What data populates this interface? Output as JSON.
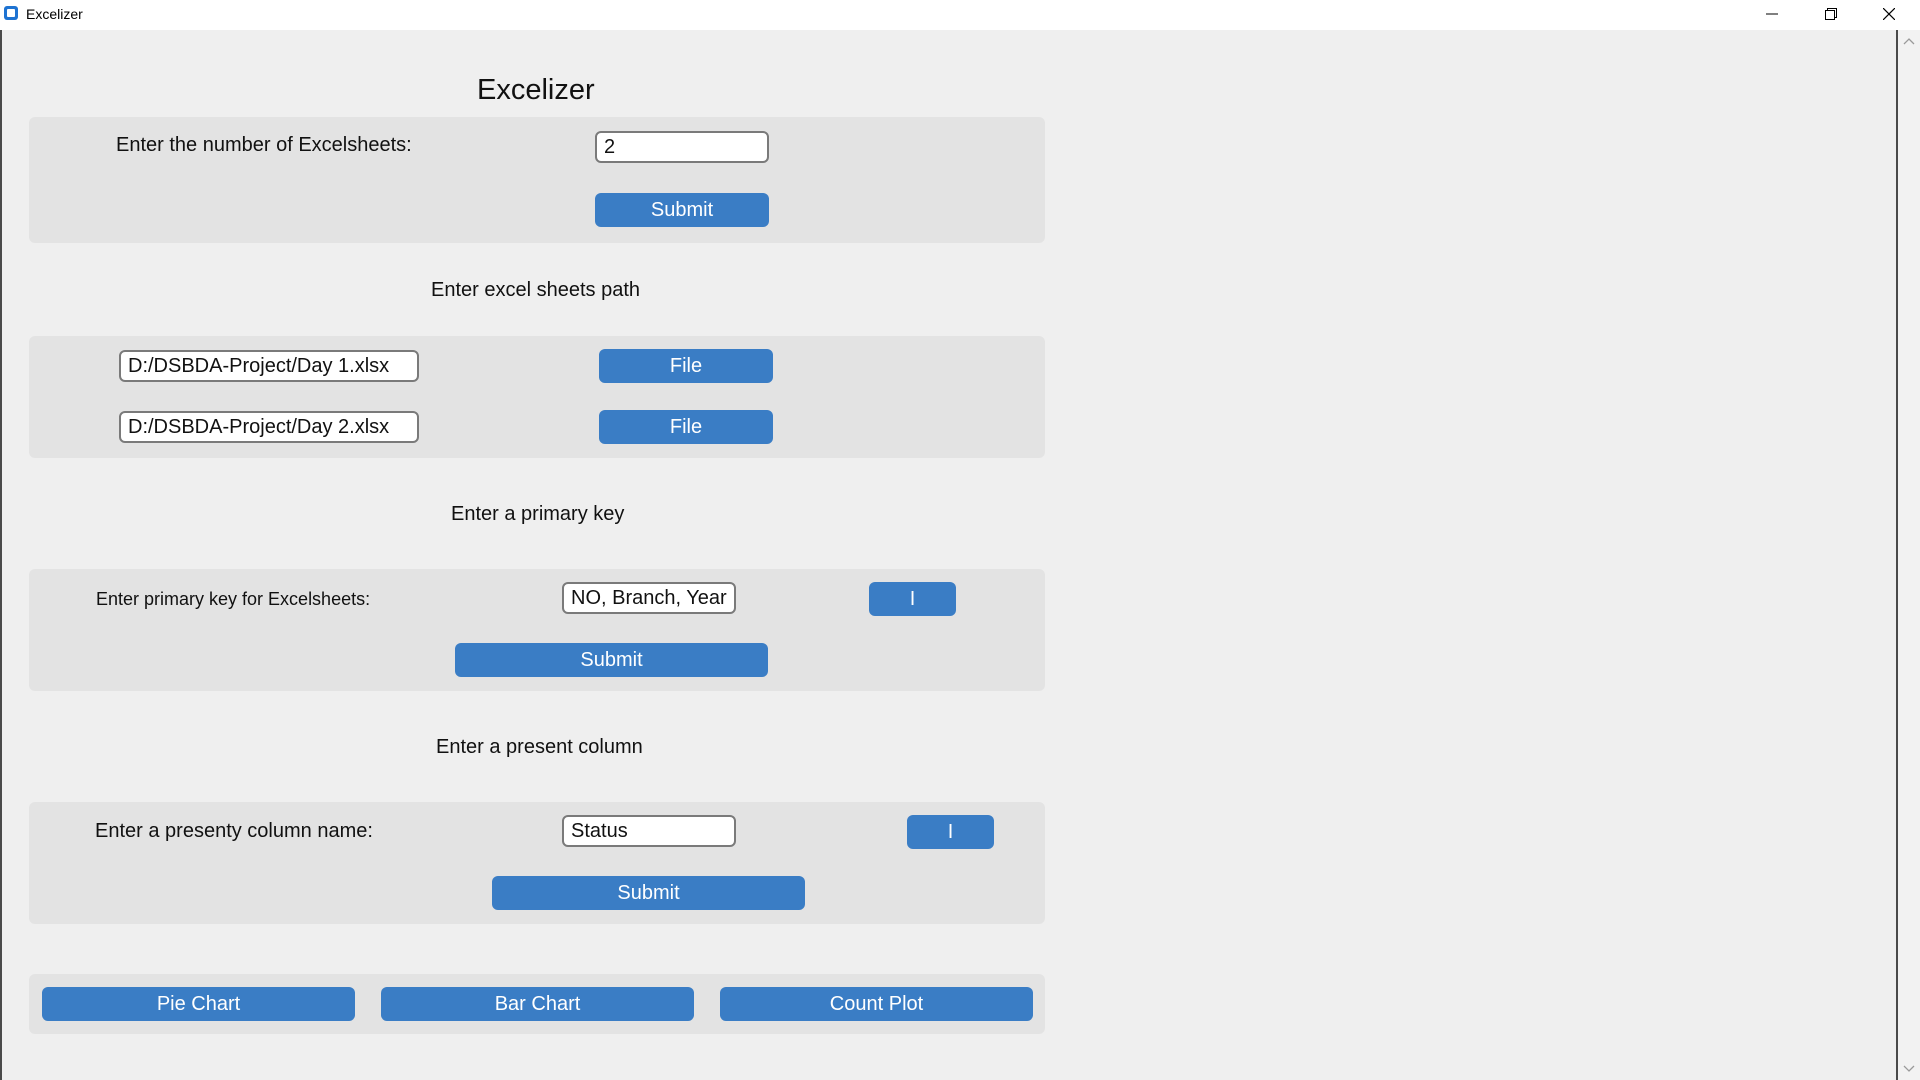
{
  "window": {
    "title": "Excelizer"
  },
  "app": {
    "heading": "Excelizer"
  },
  "sheet_count": {
    "label": "Enter the number of Excelsheets:",
    "value": "2",
    "submit_label": "Submit"
  },
  "paths": {
    "section_title": "Enter excel sheets path",
    "files": [
      {
        "value": "D:/DSBDA-Project/Day 1.xlsx",
        "button_label": "File"
      },
      {
        "value": "D:/DSBDA-Project/Day 2.xlsx",
        "button_label": "File"
      }
    ]
  },
  "primary_key": {
    "section_title": "Enter a primary key",
    "label": "Enter primary key for Excelsheets:",
    "value": "NO, Branch, Year",
    "info_label": "I",
    "submit_label": "Submit"
  },
  "present_column": {
    "section_title": "Enter a present column",
    "label": "Enter a presenty column name:",
    "value": "Status",
    "info_label": "I",
    "submit_label": "Submit"
  },
  "charts": {
    "pie_label": "Pie Chart",
    "bar_label": "Bar Chart",
    "count_label": "Count Plot"
  },
  "colors": {
    "accent": "#3a7dc5",
    "panel": "#e3e3e3",
    "background": "#efefef"
  }
}
